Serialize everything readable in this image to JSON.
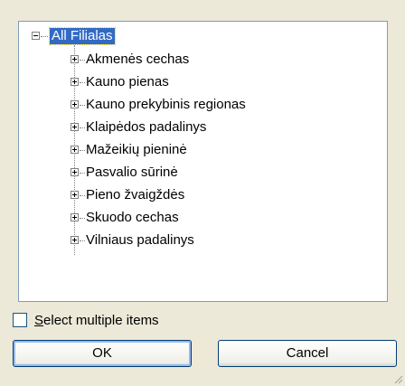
{
  "tree": {
    "root_label": "All Filialas",
    "items": [
      {
        "label": "Akmenės cechas"
      },
      {
        "label": "Kauno pienas"
      },
      {
        "label": "Kauno prekybinis regionas"
      },
      {
        "label": "Klaipėdos padalinys"
      },
      {
        "label": "Mažeikių pieninė"
      },
      {
        "label": "Pasvalio sūrinė"
      },
      {
        "label": "Pieno žvaigždės"
      },
      {
        "label": "Skuodo cechas"
      },
      {
        "label": "Vilniaus padalinys"
      }
    ]
  },
  "options": {
    "select_multiple_first": "S",
    "select_multiple_rest": "elect multiple items",
    "select_multiple_checked": false
  },
  "buttons": {
    "ok": "OK",
    "cancel": "Cancel"
  },
  "colors": {
    "selection": "#316ac5",
    "dialog_bg": "#ece9d8",
    "border": "#7f9db9"
  }
}
